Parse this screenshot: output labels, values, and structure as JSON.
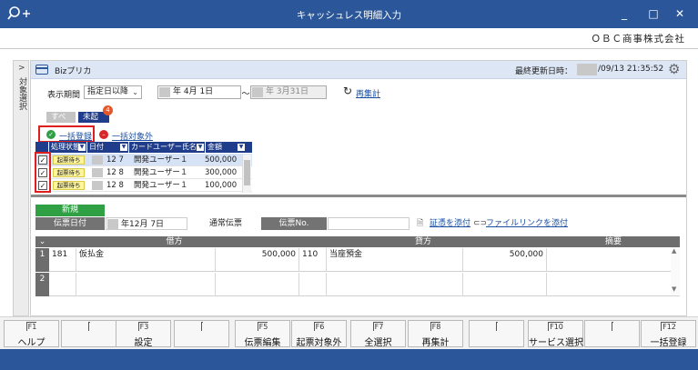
{
  "window": {
    "title": "キャッシュレス明細入力",
    "min": "_",
    "max": "□",
    "close": "✕"
  },
  "company": "ＯＢＣ商事株式会社",
  "sidebar": {
    "label": "対象選択"
  },
  "header": {
    "name": "Bizプリカ",
    "updated_label": "最終更新日時：",
    "updated_value": "/09/13 21:35:52"
  },
  "filter": {
    "period_label": "表示期間",
    "period_value": "指定日以降",
    "date_from": "年  4月  1日",
    "tilde": "～",
    "date_to": "年  3月31日",
    "recalc": "再集計"
  },
  "tabs": {
    "all": "すべて",
    "unposted": "未起票",
    "badge": "4"
  },
  "actions": {
    "register_all": "一括登録",
    "exclude_all": "一括対象外"
  },
  "list": {
    "headers": [
      "処理状態",
      "日付",
      "カードユーザー氏名",
      "金額"
    ],
    "rows": [
      {
        "checked": true,
        "status": "起票待ち",
        "date": "12  7",
        "user": "開発ユーザー１",
        "amount": "500,000"
      },
      {
        "checked": true,
        "status": "起票待ち",
        "date": "12  8",
        "user": "開発ユーザー１",
        "amount": "300,000"
      },
      {
        "checked": true,
        "status": "起票待ち",
        "date": "12  8",
        "user": "開発ユーザー１",
        "amount": "100,000"
      }
    ]
  },
  "voucher": {
    "new_label": "新規",
    "date_label": "伝票日付",
    "date_value": "年12月  7日",
    "type_value": "通常伝票",
    "no_label": "伝票No.",
    "no_value": "",
    "attach_link": "証憑を添付",
    "filelink": "ファイルリンクを添付"
  },
  "entries": {
    "headers": {
      "debit": "借方",
      "credit": "貸方",
      "memo": "摘要"
    },
    "rows": [
      {
        "num": "1",
        "debit_code": "181",
        "debit_name": "仮払金",
        "debit_amount": "500,000",
        "credit_code": "110",
        "credit_name": "当座預金",
        "credit_amount": "500,000",
        "memo": ""
      },
      {
        "num": "2",
        "debit_code": "",
        "debit_name": "",
        "debit_amount": "",
        "credit_code": "",
        "credit_name": "",
        "credit_amount": "",
        "memo": ""
      }
    ]
  },
  "fkeys": [
    {
      "key": "F1",
      "label": "ヘルプ"
    },
    {
      "key": "",
      "label": ""
    },
    {
      "key": "F3",
      "label": "設定"
    },
    {
      "key": "",
      "label": ""
    },
    {
      "key": "F5",
      "label": "伝票編集"
    },
    {
      "key": "F6",
      "label": "起票対象外"
    },
    {
      "key": "F7",
      "label": "全選択"
    },
    {
      "key": "F8",
      "label": "再集計"
    },
    {
      "key": "",
      "label": ""
    },
    {
      "key": "F10",
      "label": "サービス選択"
    },
    {
      "key": "",
      "label": ""
    },
    {
      "key": "F12",
      "label": "一括登録"
    }
  ],
  "colors": {
    "titlebar": "#2b579a",
    "grid_header": "#1f3d8a",
    "new": "#2fa043",
    "highlight": "#e01e1e",
    "status_pending": "#fff59a"
  }
}
